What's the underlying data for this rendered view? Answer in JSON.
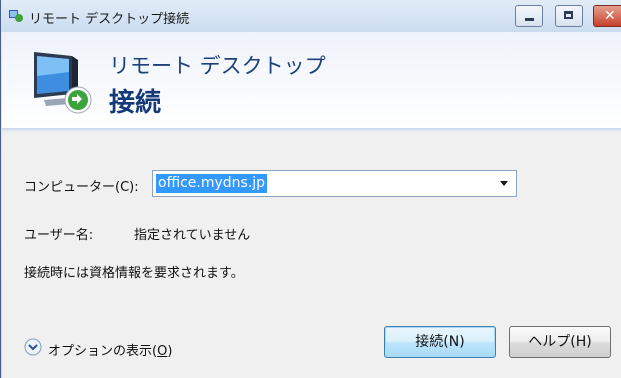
{
  "window": {
    "title": "リモート デスクトップ接続",
    "minimize_glyph": "",
    "close_glyph": "✕"
  },
  "banner": {
    "line1": "リモート デスクトップ",
    "line2": "接続"
  },
  "form": {
    "computer_label": "コンピューター(C):",
    "computer_value": "office.mydns.jp",
    "user_label": "ユーザー名:",
    "user_value": "指定されていません",
    "credentials_note": "接続時には資格情報を要求されます。"
  },
  "options": {
    "label_prefix": "オプションの表示(",
    "label_accel": "O",
    "label_suffix": ")"
  },
  "buttons": {
    "connect": "接続(N)",
    "help": "ヘルプ(H)"
  },
  "colors": {
    "desktop": "#0c1f8a",
    "selection": "#3399ff",
    "brand": "#143a7a"
  }
}
